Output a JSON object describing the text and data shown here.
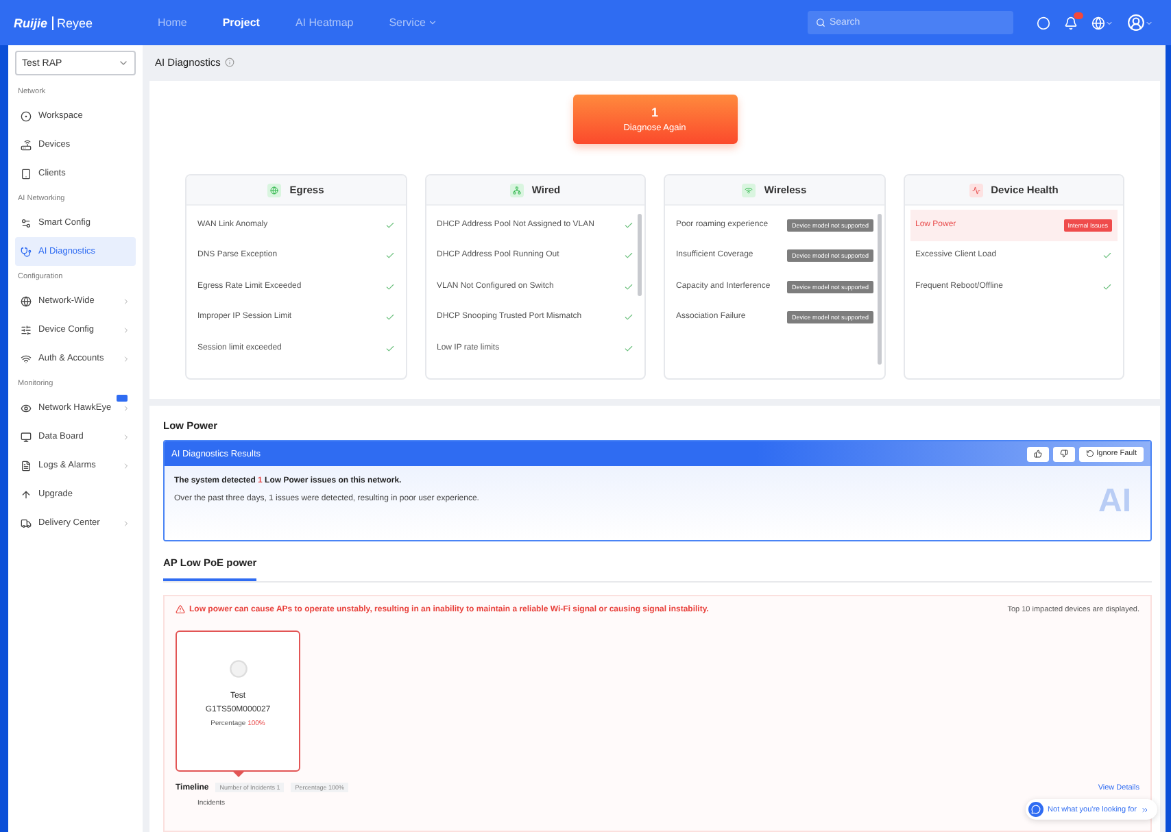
{
  "topbar": {
    "logo_brand": "Ruijie",
    "logo_product": "Reyee",
    "nav": [
      {
        "label": "Home",
        "selected": false,
        "has_caret": false
      },
      {
        "label": "Project",
        "selected": true,
        "has_caret": false
      },
      {
        "label": "AI Heatmap",
        "selected": false,
        "has_caret": false
      },
      {
        "label": "Service",
        "selected": false,
        "has_caret": true
      }
    ],
    "search": {
      "placeholder": "Search"
    },
    "notification_badge": true
  },
  "sidebar": {
    "project_select": "Test RAP",
    "groups": [
      {
        "title": "Network",
        "items": [
          {
            "label": "Workspace",
            "selected": false,
            "has_arrow": false,
            "badge": false
          },
          {
            "label": "Devices",
            "selected": false,
            "has_arrow": false,
            "badge": false
          },
          {
            "label": "Clients",
            "selected": false,
            "has_arrow": false,
            "badge": false
          }
        ]
      },
      {
        "title": "AI Networking",
        "items": [
          {
            "label": "Smart Config",
            "selected": false,
            "has_arrow": false,
            "badge": false
          },
          {
            "label": "AI Diagnostics",
            "selected": true,
            "has_arrow": false,
            "badge": false
          }
        ]
      },
      {
        "title": "Configuration",
        "items": [
          {
            "label": "Network-Wide",
            "selected": false,
            "has_arrow": true,
            "badge": false
          },
          {
            "label": "Device Config",
            "selected": false,
            "has_arrow": true,
            "badge": false
          },
          {
            "label": "Auth & Accounts",
            "selected": false,
            "has_arrow": true,
            "badge": false
          }
        ]
      },
      {
        "title": "Monitoring",
        "items": [
          {
            "label": "Network HawkEye",
            "selected": false,
            "has_arrow": true,
            "badge": true
          },
          {
            "label": "Data Board",
            "selected": false,
            "has_arrow": true,
            "badge": false
          },
          {
            "label": "Logs & Alarms",
            "selected": false,
            "has_arrow": true,
            "badge": false
          },
          {
            "label": "Upgrade",
            "selected": false,
            "has_arrow": false,
            "badge": false
          },
          {
            "label": "Delivery Center",
            "selected": false,
            "has_arrow": true,
            "badge": false
          }
        ]
      }
    ]
  },
  "breadcrumb": {
    "title": "AI Diagnostics"
  },
  "diagnose_button": {
    "count": "1",
    "label": "Diagnose Again"
  },
  "categories": [
    {
      "title": "Egress",
      "kind": "ok",
      "items": [
        {
          "label": "WAN Link Anomaly",
          "kind": "ok"
        },
        {
          "label": "DNS Parse Exception",
          "kind": "ok"
        },
        {
          "label": "Egress Rate Limit Exceeded",
          "kind": "ok"
        },
        {
          "label": "Improper IP Session Limit",
          "kind": "ok"
        },
        {
          "label": "Session limit exceeded",
          "kind": "ok"
        }
      ]
    },
    {
      "title": "Wired",
      "kind": "ok",
      "items": [
        {
          "label": "DHCP Address Pool Not Assigned to VLAN",
          "kind": "ok"
        },
        {
          "label": "DHCP Address Pool Running Out",
          "kind": "ok"
        },
        {
          "label": "VLAN Not Configured on Switch",
          "kind": "ok"
        },
        {
          "label": "DHCP Snooping Trusted Port Mismatch",
          "kind": "ok"
        },
        {
          "label": "Low IP rate limits",
          "kind": "ok"
        }
      ]
    },
    {
      "title": "Wireless",
      "kind": "ok",
      "items": [
        {
          "label": "Poor roaming experience",
          "kind": "tag",
          "tag": "Device model not supported"
        },
        {
          "label": "Insufficient Coverage",
          "kind": "tag",
          "tag": "Device model not supported"
        },
        {
          "label": "Capacity and Interference",
          "kind": "tag",
          "tag": "Device model not supported"
        },
        {
          "label": "Association Failure",
          "kind": "tag",
          "tag": "Device model not supported"
        }
      ]
    },
    {
      "title": "Device Health",
      "kind": "issue",
      "items": [
        {
          "label": "Low Power",
          "kind": "issue",
          "tag": "Internal Issues"
        },
        {
          "label": "Excessive Client Load",
          "kind": "ok"
        },
        {
          "label": "Frequent Reboot/Offline",
          "kind": "ok"
        }
      ]
    }
  ],
  "detail": {
    "title": "Low Power",
    "results": {
      "title": "AI Diagnostics Results",
      "ignore_button": "Ignore Fault",
      "summary_before": "The system detected ",
      "summary_count": "1",
      "summary_after": " Low Power issues on this network.",
      "description": "Over the past three days, 1 issues were detected, resulting in poor user experience.",
      "ai_mark": "AI"
    },
    "tabs": [
      {
        "label": "AP Low PoE power",
        "selected": true
      }
    ],
    "warning": "Low power can cause APs to operate unstably, resulting in an inability to maintain a reliable Wi-Fi signal or causing signal instability.",
    "warning_note": "Top 10 impacted devices are displayed.",
    "devices": [
      {
        "name": "Test",
        "serial": "G1TS50M000027",
        "percentage_label": "Percentage",
        "percentage": "100%",
        "selected": true
      }
    ],
    "timeline": {
      "title": "Timeline",
      "tags": [
        "Number of Incidents 1",
        "Percentage 100%"
      ],
      "incidents_label": "Incidents",
      "view_details": "View Details"
    },
    "help_link": "Not what you're looking for"
  }
}
